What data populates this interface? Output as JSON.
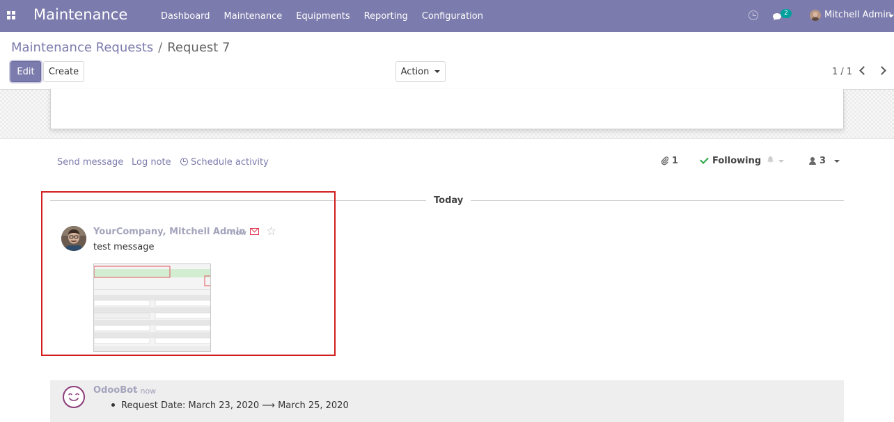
{
  "app": {
    "title": "Maintenance",
    "apps_icon": "apps-grid-icon",
    "menu": [
      "Dashboard",
      "Maintenance",
      "Equipments",
      "Reporting",
      "Configuration"
    ],
    "notification_count": "2",
    "user_name": "Mitchell Admin",
    "accent_color": "#7c7bad"
  },
  "breadcrumb": {
    "parent": "Maintenance Requests",
    "separator": "/",
    "current": "Request 7"
  },
  "control": {
    "edit_label": "Edit",
    "create_label": "Create",
    "action_label": "Action",
    "pager": "1 / 1"
  },
  "chatter": {
    "send_message": "Send message",
    "log_note": "Log note",
    "schedule_activity": "Schedule activity",
    "attachment_count": "1",
    "following_label": "Following",
    "follower_count": "3",
    "date_separator": "Today"
  },
  "messages": [
    {
      "author": "YourCompany, Mitchell Admin",
      "date": "- now",
      "body": "test message",
      "highlight_color": "#d21e1e"
    },
    {
      "author": "OdooBot",
      "date": "- now",
      "tracking": "Request Date: March 23, 2020 ⟶ March 25, 2020"
    }
  ]
}
